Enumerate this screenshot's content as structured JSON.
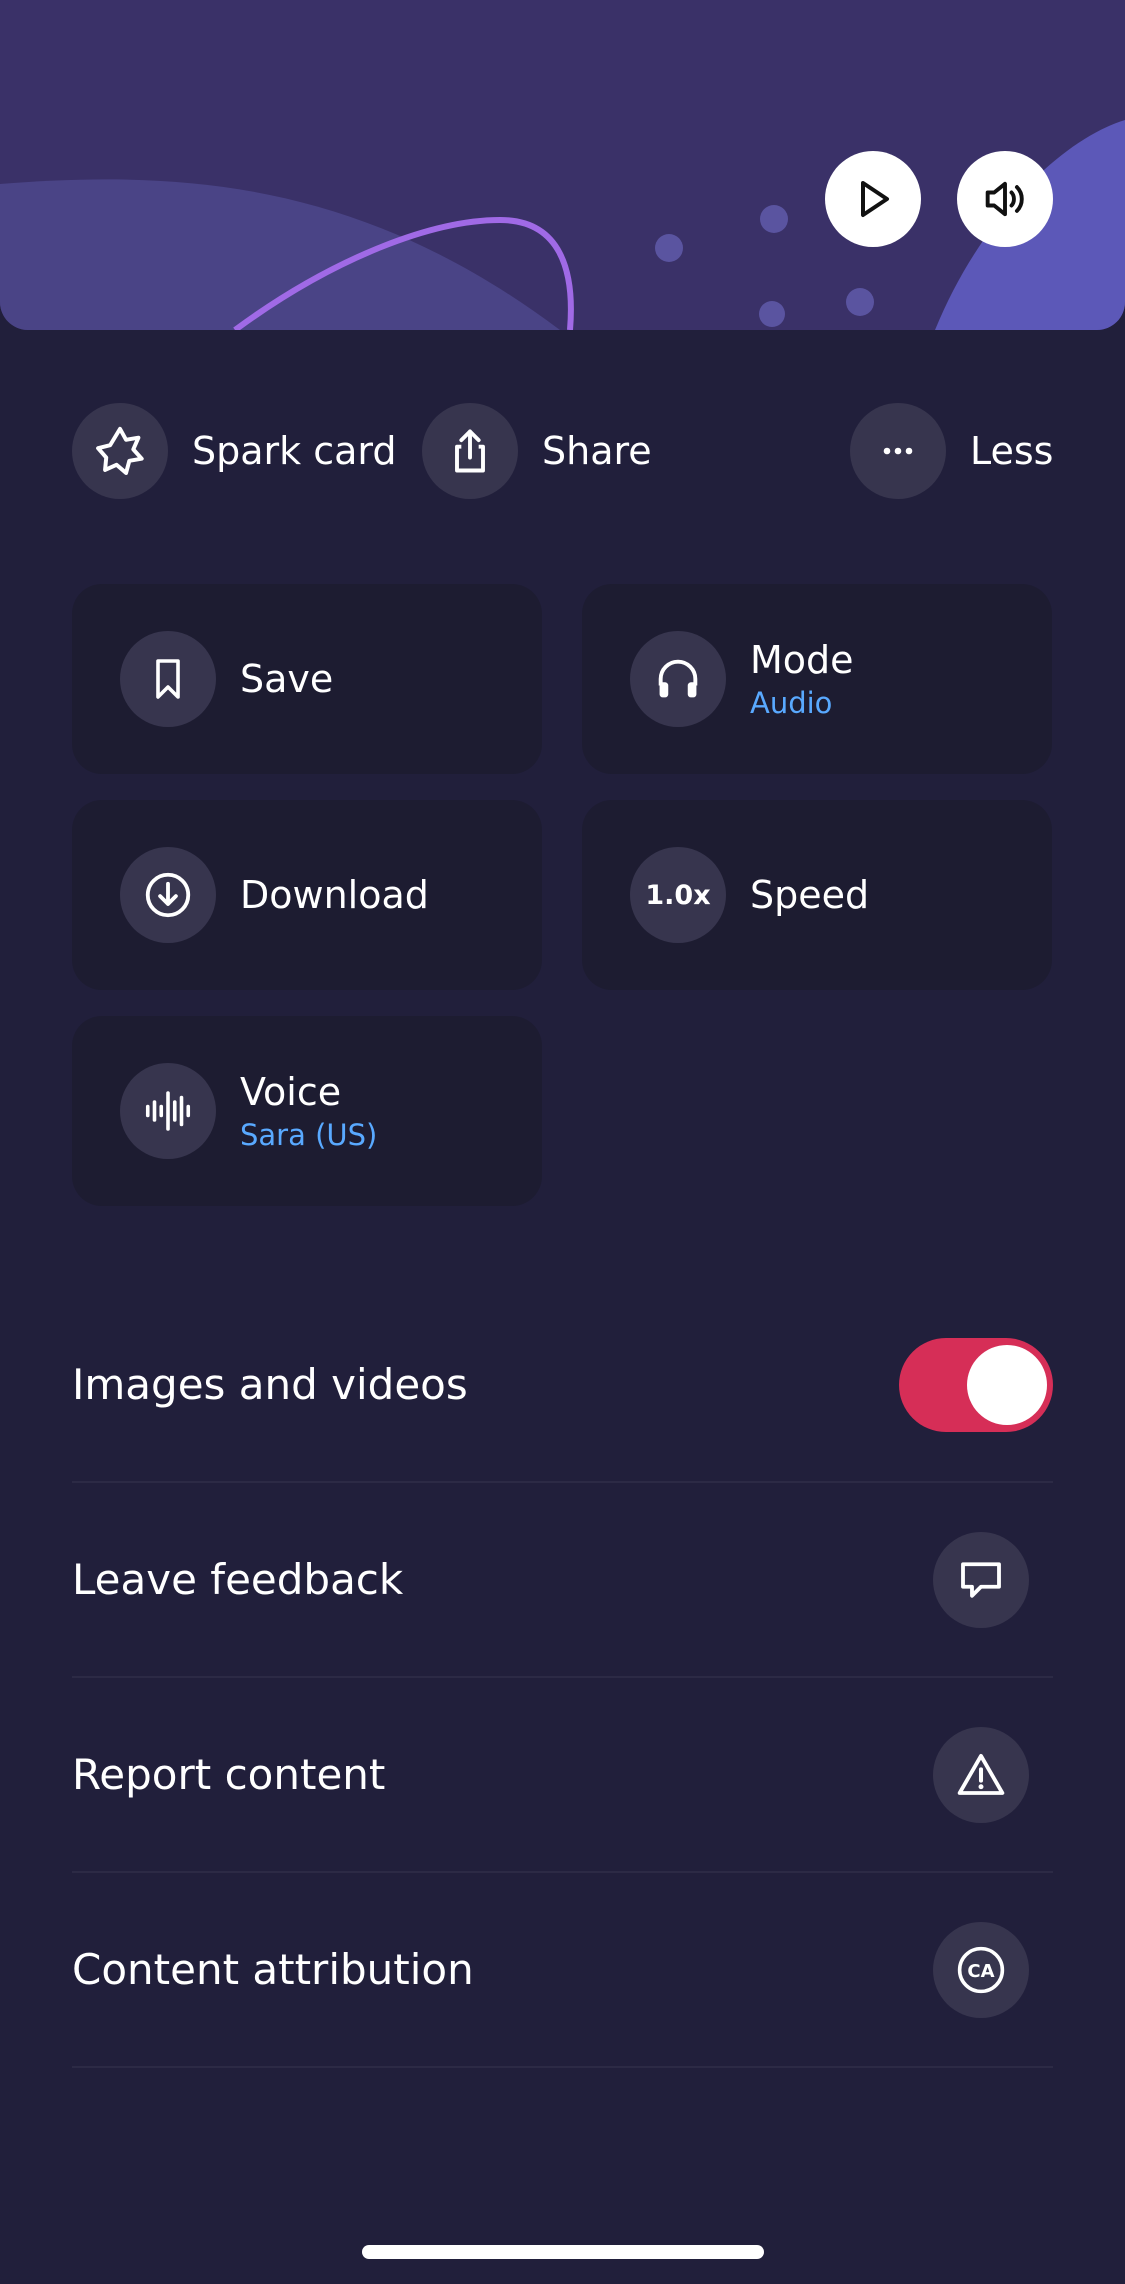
{
  "quick_actions": [
    {
      "label": "Spark card",
      "icon": "spark-icon"
    },
    {
      "label": "Share",
      "icon": "share-icon"
    },
    {
      "label": "Less",
      "icon": "more-dots-icon"
    }
  ],
  "tiles": {
    "save": {
      "title": "Save",
      "icon": "bookmark-icon"
    },
    "mode": {
      "title": "Mode",
      "value": "Audio",
      "icon": "headphones-icon"
    },
    "download": {
      "title": "Download",
      "icon": "download-icon"
    },
    "speed": {
      "title": "Speed",
      "badge": "1.0x"
    },
    "voice": {
      "title": "Voice",
      "value": "Sara (US)",
      "icon": "waveform-icon"
    }
  },
  "settings": {
    "images_videos": {
      "label": "Images and videos",
      "enabled": true
    },
    "feedback": {
      "label": "Leave feedback",
      "icon": "speech-bubble-icon"
    },
    "report": {
      "label": "Report content",
      "icon": "warning-icon"
    },
    "attribution": {
      "label": "Content attribution",
      "icon_text": "CA"
    }
  },
  "colors": {
    "background": "#211f3b",
    "tile": "#1d1c31",
    "accent_blue": "#59a9ff",
    "toggle_on": "#d62e57"
  }
}
